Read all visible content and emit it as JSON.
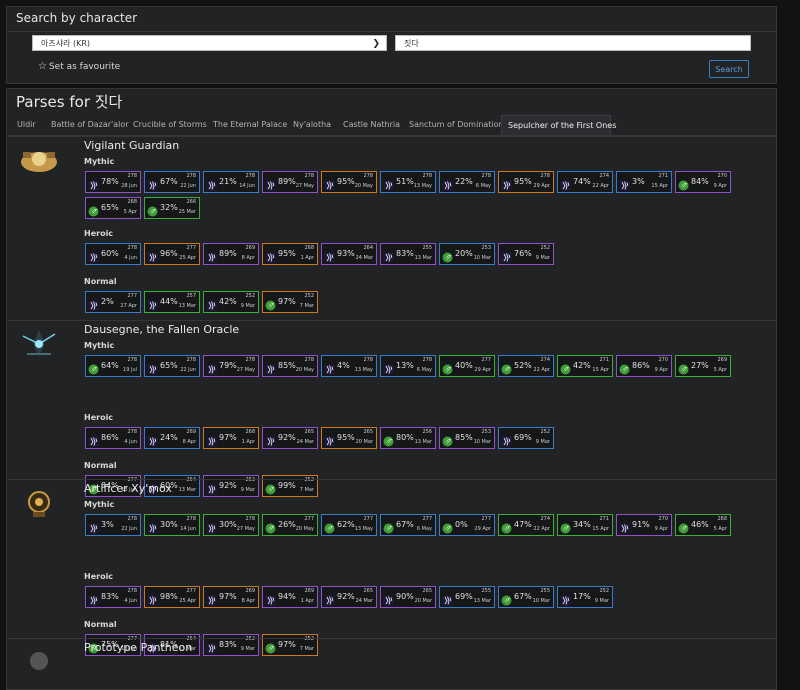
{
  "search": {
    "header": "Search by character",
    "realm_value": "아즈샤라 (KR)",
    "name_value": "짓다",
    "favourite_label": "Set as favourite",
    "search_button": "Search"
  },
  "parses": {
    "title": "Parses for 짓다",
    "tabs": [
      "Uldir",
      "Battle of Dazar'alor",
      "Crucible of Storms",
      "The Eternal Palace",
      "Ny'alotha",
      "Castle Nathria",
      "Sanctum of Domination",
      "Sepulcher of the First Ones"
    ],
    "active_tab": 7
  },
  "colors": {
    "rare": "#3c7cc7",
    "epic": "#8f53c9",
    "legendary": "#cc7a22",
    "uncommon": "#3cad37"
  },
  "bosses": [
    {
      "name": "Vigilant Guardian",
      "icon": "vigilant-guardian-icon",
      "sections": [
        {
          "label": "Mythic",
          "rows": [
            [
              {
                "pct": "78%",
                "ilvl": "278",
                "date": "28 Jun",
                "q": "epic",
                "spec": "claw"
              },
              {
                "pct": "67%",
                "ilvl": "278",
                "date": "22 Jun",
                "q": "rare",
                "spec": "claw"
              },
              {
                "pct": "21%",
                "ilvl": "278",
                "date": "14 Jun",
                "q": "rare",
                "spec": "claw"
              },
              {
                "pct": "89%",
                "ilvl": "278",
                "date": "27 May",
                "q": "epic",
                "spec": "claw"
              },
              {
                "pct": "95%",
                "ilvl": "278",
                "date": "20 May",
                "q": "leg",
                "spec": "claw"
              },
              {
                "pct": "51%",
                "ilvl": "278",
                "date": "13 May",
                "q": "rare",
                "spec": "claw"
              },
              {
                "pct": "22%",
                "ilvl": "278",
                "date": "6 May",
                "q": "rare",
                "spec": "claw"
              },
              {
                "pct": "95%",
                "ilvl": "278",
                "date": "29 Apr",
                "q": "leg",
                "spec": "claw"
              },
              {
                "pct": "74%",
                "ilvl": "274",
                "date": "22 Apr",
                "q": "rare",
                "spec": "claw"
              },
              {
                "pct": "3%",
                "ilvl": "271",
                "date": "15 Apr",
                "q": "rare",
                "spec": "claw"
              },
              {
                "pct": "84%",
                "ilvl": "270",
                "date": "9 Apr",
                "q": "epic",
                "spec": "leaf"
              }
            ],
            [
              {
                "pct": "65%",
                "ilvl": "268",
                "date": "5 Apr",
                "q": "epic",
                "spec": "leaf"
              },
              {
                "pct": "32%",
                "ilvl": "266",
                "date": "25 Mar",
                "q": "unc",
                "spec": "leaf"
              }
            ]
          ]
        },
        {
          "label": "Heroic",
          "rows": [
            [
              {
                "pct": "60%",
                "ilvl": "278",
                "date": "4 Jun",
                "q": "rare",
                "spec": "claw"
              },
              {
                "pct": "96%",
                "ilvl": "277",
                "date": "25 Apr",
                "q": "leg",
                "spec": "claw"
              },
              {
                "pct": "89%",
                "ilvl": "269",
                "date": "8 Apr",
                "q": "epic",
                "spec": "claw"
              },
              {
                "pct": "95%",
                "ilvl": "268",
                "date": "1 Apr",
                "q": "leg",
                "spec": "claw"
              },
              {
                "pct": "93%",
                "ilvl": "264",
                "date": "24 Mar",
                "q": "epic",
                "spec": "claw"
              },
              {
                "pct": "83%",
                "ilvl": "255",
                "date": "13 Mar",
                "q": "epic",
                "spec": "claw"
              },
              {
                "pct": "20%",
                "ilvl": "253",
                "date": "10 Mar",
                "q": "rare",
                "spec": "leaf"
              },
              {
                "pct": "76%",
                "ilvl": "252",
                "date": "9 Mar",
                "q": "epic",
                "spec": "claw"
              }
            ]
          ]
        },
        {
          "label": "Normal",
          "rows": [
            [
              {
                "pct": "2%",
                "ilvl": "277",
                "date": "27 Apr",
                "q": "rare",
                "spec": "claw"
              },
              {
                "pct": "44%",
                "ilvl": "257",
                "date": "13 Mar",
                "q": "unc",
                "spec": "claw"
              },
              {
                "pct": "42%",
                "ilvl": "252",
                "date": "9 Mar",
                "q": "unc",
                "spec": "claw"
              },
              {
                "pct": "97%",
                "ilvl": "252",
                "date": "7 Mar",
                "q": "leg",
                "spec": "leaf"
              }
            ]
          ]
        }
      ]
    },
    {
      "name": "Dausegne, the Fallen Oracle",
      "icon": "dausegne-icon",
      "sections": [
        {
          "label": "Mythic",
          "rows": [
            [
              {
                "pct": "64%",
                "ilvl": "278",
                "date": "19 Jul",
                "q": "rare",
                "spec": "leaf"
              },
              {
                "pct": "65%",
                "ilvl": "278",
                "date": "22 Jun",
                "q": "rare",
                "spec": "claw"
              },
              {
                "pct": "79%",
                "ilvl": "278",
                "date": "27 May",
                "q": "epic",
                "spec": "claw"
              },
              {
                "pct": "85%",
                "ilvl": "278",
                "date": "20 May",
                "q": "epic",
                "spec": "claw"
              },
              {
                "pct": "4%",
                "ilvl": "278",
                "date": "13 May",
                "q": "rare",
                "spec": "claw"
              },
              {
                "pct": "13%",
                "ilvl": "278",
                "date": "6 May",
                "q": "rare",
                "spec": "claw"
              },
              {
                "pct": "40%",
                "ilvl": "277",
                "date": "29 Apr",
                "q": "unc",
                "spec": "leaf"
              },
              {
                "pct": "52%",
                "ilvl": "274",
                "date": "22 Apr",
                "q": "rare",
                "spec": "leaf"
              },
              {
                "pct": "42%",
                "ilvl": "271",
                "date": "15 Apr",
                "q": "unc",
                "spec": "leaf"
              },
              {
                "pct": "86%",
                "ilvl": "270",
                "date": "9 Apr",
                "q": "epic",
                "spec": "leaf"
              },
              {
                "pct": "27%",
                "ilvl": "269",
                "date": "5 Apr",
                "q": "unc",
                "spec": "leaf"
              }
            ]
          ]
        },
        {
          "label": "Heroic",
          "rows": [
            [
              {
                "pct": "86%",
                "ilvl": "278",
                "date": "4 Jun",
                "q": "epic",
                "spec": "claw"
              },
              {
                "pct": "24%",
                "ilvl": "269",
                "date": "8 Apr",
                "q": "rare",
                "spec": "claw"
              },
              {
                "pct": "97%",
                "ilvl": "268",
                "date": "1 Apr",
                "q": "leg",
                "spec": "claw"
              },
              {
                "pct": "92%",
                "ilvl": "265",
                "date": "24 Mar",
                "q": "epic",
                "spec": "claw"
              },
              {
                "pct": "95%",
                "ilvl": "265",
                "date": "20 Mar",
                "q": "leg",
                "spec": "claw"
              },
              {
                "pct": "80%",
                "ilvl": "256",
                "date": "13 Mar",
                "q": "epic",
                "spec": "leaf"
              },
              {
                "pct": "85%",
                "ilvl": "253",
                "date": "10 Mar",
                "q": "epic",
                "spec": "leaf"
              },
              {
                "pct": "69%",
                "ilvl": "252",
                "date": "9 Mar",
                "q": "rare",
                "spec": "claw"
              }
            ]
          ]
        },
        {
          "label": "Normal",
          "rows": [
            [
              {
                "pct": "84%",
                "ilvl": "277",
                "date": "13 Jun",
                "q": "epic",
                "spec": "leaf"
              },
              {
                "pct": "60%",
                "ilvl": "254",
                "date": "13 Mar",
                "q": "rare",
                "spec": "claw"
              },
              {
                "pct": "92%",
                "ilvl": "252",
                "date": "9 Mar",
                "q": "epic",
                "spec": "claw"
              },
              {
                "pct": "99%",
                "ilvl": "252",
                "date": "7 Mar",
                "q": "leg",
                "spec": "leaf"
              }
            ]
          ]
        }
      ]
    },
    {
      "name": "Artificer Xy'mox",
      "icon": "artificer-xymox-icon",
      "sections": [
        {
          "label": "Mythic",
          "rows": [
            [
              {
                "pct": "3%",
                "ilvl": "278",
                "date": "22 Jun",
                "q": "rare",
                "spec": "claw"
              },
              {
                "pct": "30%",
                "ilvl": "278",
                "date": "14 Jun",
                "q": "unc",
                "spec": "claw"
              },
              {
                "pct": "30%",
                "ilvl": "278",
                "date": "27 May",
                "q": "unc",
                "spec": "claw"
              },
              {
                "pct": "26%",
                "ilvl": "277",
                "date": "20 May",
                "q": "unc",
                "spec": "leaf"
              },
              {
                "pct": "62%",
                "ilvl": "277",
                "date": "13 May",
                "q": "rare",
                "spec": "leaf"
              },
              {
                "pct": "67%",
                "ilvl": "277",
                "date": "6 May",
                "q": "rare",
                "spec": "leaf"
              },
              {
                "pct": "0%",
                "ilvl": "277",
                "date": "29 Apr",
                "q": "rare",
                "spec": "leaf"
              },
              {
                "pct": "47%",
                "ilvl": "274",
                "date": "22 Apr",
                "q": "unc",
                "spec": "leaf"
              },
              {
                "pct": "34%",
                "ilvl": "271",
                "date": "15 Apr",
                "q": "unc",
                "spec": "leaf"
              },
              {
                "pct": "91%",
                "ilvl": "270",
                "date": "9 Apr",
                "q": "epic",
                "spec": "claw"
              },
              {
                "pct": "46%",
                "ilvl": "268",
                "date": "5 Apr",
                "q": "unc",
                "spec": "leaf"
              }
            ]
          ]
        },
        {
          "label": "Heroic",
          "rows": [
            [
              {
                "pct": "83%",
                "ilvl": "278",
                "date": "4 Jun",
                "q": "epic",
                "spec": "claw"
              },
              {
                "pct": "98%",
                "ilvl": "277",
                "date": "25 Apr",
                "q": "leg",
                "spec": "claw"
              },
              {
                "pct": "97%",
                "ilvl": "269",
                "date": "8 Apr",
                "q": "leg",
                "spec": "claw"
              },
              {
                "pct": "94%",
                "ilvl": "269",
                "date": "1 Apr",
                "q": "epic",
                "spec": "claw"
              },
              {
                "pct": "92%",
                "ilvl": "265",
                "date": "24 Mar",
                "q": "epic",
                "spec": "claw"
              },
              {
                "pct": "90%",
                "ilvl": "265",
                "date": "20 Mar",
                "q": "epic",
                "spec": "claw"
              },
              {
                "pct": "69%",
                "ilvl": "255",
                "date": "13 Mar",
                "q": "rare",
                "spec": "claw"
              },
              {
                "pct": "67%",
                "ilvl": "255",
                "date": "10 Mar",
                "q": "rare",
                "spec": "leaf"
              },
              {
                "pct": "17%",
                "ilvl": "252",
                "date": "9 Mar",
                "q": "rare",
                "spec": "claw"
              }
            ]
          ]
        },
        {
          "label": "Normal",
          "rows": [
            [
              {
                "pct": "75%",
                "ilvl": "277",
                "date": "13 Jun",
                "q": "epic",
                "spec": "leaf"
              },
              {
                "pct": "81%",
                "ilvl": "254",
                "date": "13 Mar",
                "q": "epic",
                "spec": "claw"
              },
              {
                "pct": "83%",
                "ilvl": "252",
                "date": "9 Mar",
                "q": "epic",
                "spec": "claw"
              },
              {
                "pct": "97%",
                "ilvl": "252",
                "date": "7 Mar",
                "q": "leg",
                "spec": "leaf"
              }
            ]
          ]
        }
      ]
    },
    {
      "name": "Prototype Pantheon",
      "icon": "prototype-pantheon-icon",
      "sections": []
    }
  ]
}
